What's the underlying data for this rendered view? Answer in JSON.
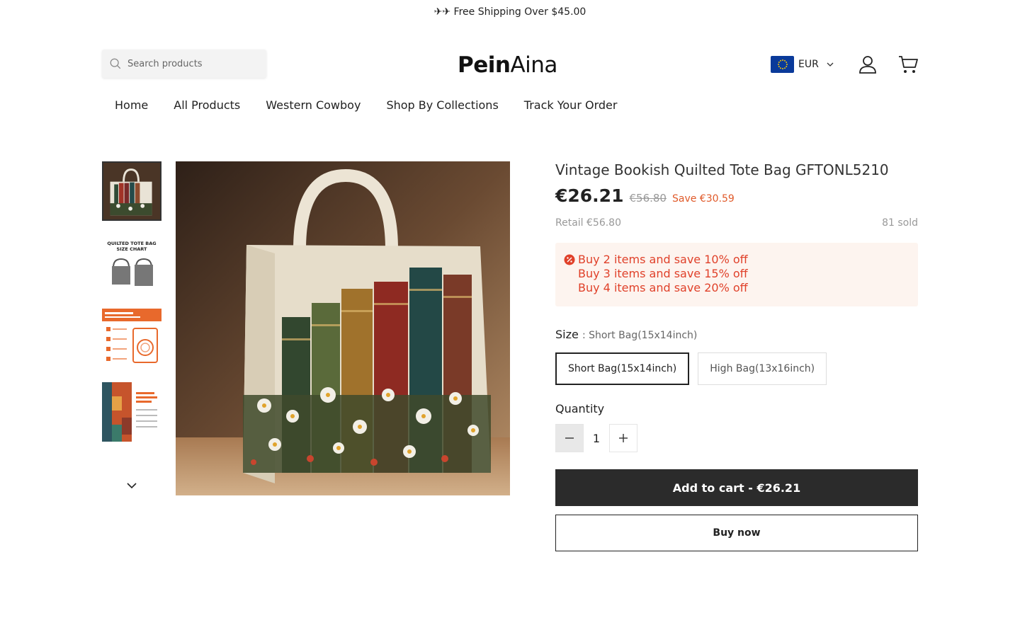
{
  "announcement": "✈✈ Free Shipping Over $45.00",
  "search": {
    "placeholder": "Search products"
  },
  "logo": {
    "part1": "Pein",
    "part2": "Aina"
  },
  "currency": {
    "code": "EUR"
  },
  "nav": [
    {
      "label": "Home"
    },
    {
      "label": "All Products"
    },
    {
      "label": "Western Cowboy"
    },
    {
      "label": "Shop By Collections"
    },
    {
      "label": "Track Your Order"
    }
  ],
  "thumbnails": [
    {
      "icon": "tote-bag-image"
    },
    {
      "icon": "size-chart-image",
      "caption": "QUILTED TOTE BAG SIZE CHART"
    },
    {
      "icon": "care-instructions-image"
    },
    {
      "icon": "fabric-detail-image"
    }
  ],
  "product": {
    "title": "Vintage Bookish Quilted Tote Bag GFTONL5210",
    "price": "€26.21",
    "compare_price": "€56.80",
    "save": "Save €30.59",
    "retail": "Retail €56.80",
    "sold": "81 sold",
    "promos": [
      "Buy 2 items and save 10% off",
      "Buy 3 items and save 15% off",
      "Buy 4 items and save 20% off"
    ],
    "size_label": "Size",
    "size_selected": ": Short Bag(15x14inch)",
    "sizes": [
      "Short Bag(15x14inch)",
      "High Bag(13x16inch)"
    ],
    "quantity_label": "Quantity",
    "quantity": "1",
    "add_to_cart": "Add to cart - €26.21",
    "buy_now": "Buy now"
  },
  "colors": {
    "accent_sale": "#e05a2a",
    "promo_text": "#e0412a",
    "promo_bg": "#fdf4ef",
    "cart_button": "#2b2b2b",
    "flag_blue": "#0a3a9a"
  }
}
